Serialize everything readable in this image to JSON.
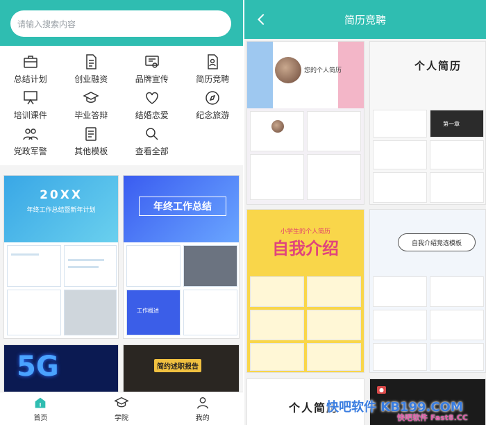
{
  "home": {
    "search": {
      "placeholder": "请输入搜索内容"
    },
    "categories": [
      {
        "label": "总结计划",
        "icon": "briefcase-icon"
      },
      {
        "label": "创业融资",
        "icon": "document-icon"
      },
      {
        "label": "品牌宣传",
        "icon": "certificate-icon"
      },
      {
        "label": "简历竞聘",
        "icon": "resume-icon"
      },
      {
        "label": "培训课件",
        "icon": "easel-icon"
      },
      {
        "label": "毕业答辩",
        "icon": "graduation-cap-icon"
      },
      {
        "label": "结婚恋爱",
        "icon": "heart-icon"
      },
      {
        "label": "纪念旅游",
        "icon": "compass-icon"
      },
      {
        "label": "党政军警",
        "icon": "people-icon"
      },
      {
        "label": "其他模板",
        "icon": "book-icon"
      },
      {
        "label": "查看全部",
        "icon": "search-doc-icon"
      }
    ],
    "templates": [
      {
        "title": "20XX",
        "subtitle": "年终工作总结暨新年计划"
      },
      {
        "title": "年终工作总结",
        "section": "工作概述"
      },
      {
        "title": "5G"
      },
      {
        "title": "简约述职报告"
      }
    ],
    "tabbar": [
      {
        "label": "首页",
        "icon": "home-icon"
      },
      {
        "label": "学院",
        "icon": "graduation-cap-icon"
      },
      {
        "label": "我的",
        "icon": "user-icon"
      }
    ]
  },
  "resume_page": {
    "title": "简历竞聘",
    "back_icon": "chevron-left-icon",
    "templates": [
      {
        "name": "您的个人简历"
      },
      {
        "title": "个人简历",
        "section": "第一章"
      },
      {
        "sub": "小学生的个人简历",
        "title": "自我介绍"
      },
      {
        "title": "自我介绍竞选模板"
      },
      {
        "title": "个人简历"
      },
      {
        "title": ""
      }
    ]
  },
  "watermark": {
    "main": "快吧软件 KB199.COM",
    "sub": "快吧软件 Fast8.CC"
  },
  "colors": {
    "accent": "#2fbdb1"
  }
}
